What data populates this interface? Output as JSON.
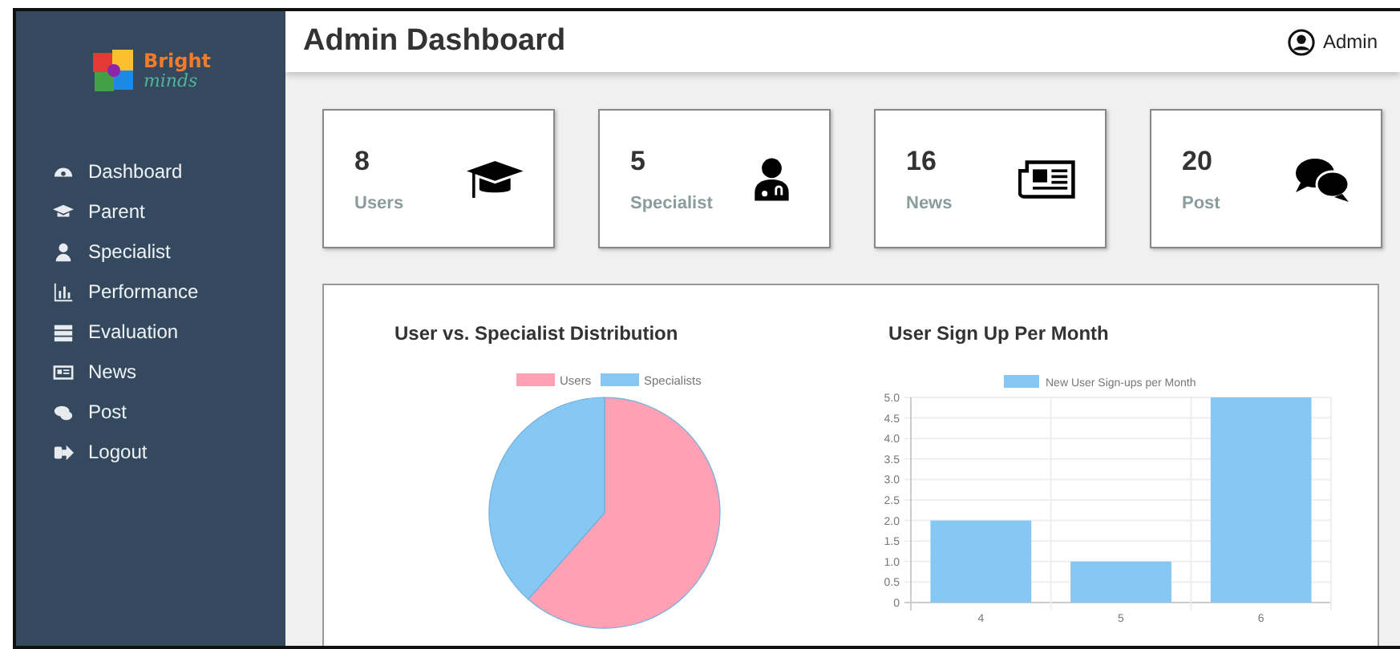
{
  "sidebar": {
    "logo": {
      "line_1": "Bright",
      "line_2": "minds"
    },
    "items": [
      {
        "label": "Dashboard"
      },
      {
        "label": "Parent"
      },
      {
        "label": "Specialist"
      },
      {
        "label": "Performance"
      },
      {
        "label": "Evaluation"
      },
      {
        "label": "News"
      },
      {
        "label": "Post"
      },
      {
        "label": "Logout"
      }
    ]
  },
  "header": {
    "title": "Admin Dashboard",
    "user": "Admin"
  },
  "cards": [
    {
      "value": "8",
      "label": "Users"
    },
    {
      "value": "5",
      "label": "Specialist"
    },
    {
      "value": "16",
      "label": "News"
    },
    {
      "value": "20",
      "label": "Post"
    }
  ],
  "charts": [
    {
      "chart_data": {
        "type": "pie",
        "title": "User vs. Specialist Distribution",
        "categories": [
          "Users",
          "Specialists"
        ],
        "values": [
          61.5,
          38.5
        ],
        "colors": [
          "#ffa1b5",
          "#86c7f3"
        ],
        "legend": "top"
      }
    },
    {
      "chart_data": {
        "type": "bar",
        "title": "User Sign Up Per Month",
        "categories": [
          "4",
          "5",
          "6"
        ],
        "series": [
          {
            "name": "New User Sign-ups per Month",
            "color": "#86c7f3",
            "values": [
              2,
              1,
              5
            ]
          }
        ],
        "legend": "top",
        "grid": true,
        "ylim": [
          0,
          5
        ],
        "yticks": [
          0,
          {
            "value": 0.5,
            "label": "0.5"
          },
          {
            "value": 1,
            "label": "1.0"
          },
          {
            "value": 1.5,
            "label": "1.5"
          },
          {
            "value": 2,
            "label": "2.0"
          },
          {
            "value": 2.5,
            "label": "2.5"
          },
          {
            "value": 3,
            "label": "3.0"
          },
          {
            "value": 3.5,
            "label": "3.5"
          },
          {
            "value": 4,
            "label": "4.0"
          },
          {
            "value": 4.5,
            "label": "4.5"
          },
          {
            "value": 5,
            "label": "5.0"
          }
        ]
      }
    }
  ]
}
